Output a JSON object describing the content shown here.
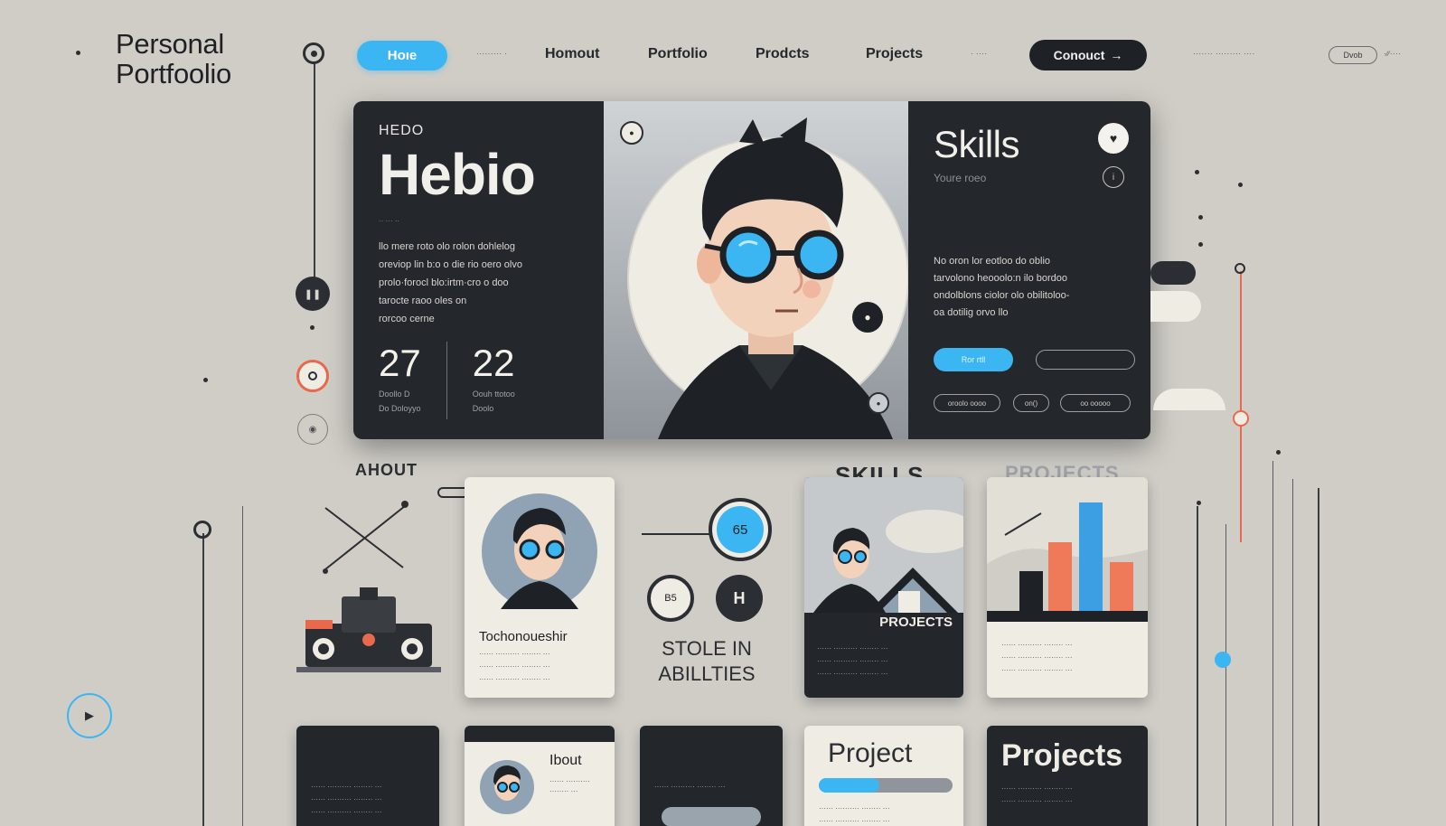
{
  "brand": {
    "line1": "Personal",
    "line2": "Portfoolio"
  },
  "nav": {
    "home": "Hoıe",
    "small1": "·········  ·",
    "about": "Homout",
    "portfolio": "Portfolio",
    "products": "Prodcts",
    "projects": "Projects",
    "small2": "· ····",
    "contact": "Conouct",
    "contact_arrow": "→",
    "right_small": "·······  ········· ····",
    "pill": "Dvob",
    "right_small2": "·∕∕····"
  },
  "hero": {
    "kicker": "HEDO",
    "title": "Hebio",
    "tiny": "·· ··· ··",
    "paragraph": [
      "llo mere roto olo rolon dohlelog",
      "oreviop lin b:o o die rio oero olvo",
      "prolo·forocl blo:irtm·cro o doo",
      "tarocte raoo oles on",
      "rorcoo cerne"
    ],
    "stats": [
      {
        "num": "27",
        "label1": "Doollo D",
        "label2": "Do Doloyyo"
      },
      {
        "num": "22",
        "label1": "Oouh ttotoo",
        "label2": "Doolo"
      }
    ],
    "skills_title": "Skills",
    "skills_sub": "Youre roeo",
    "right_paragraph": [
      "No oron lor eotloo do oblio",
      "tarvolono heooolo:n ilo bordoo",
      "ondolblons ciolor olo obilitoloo-",
      "oa dotilig orvo llo"
    ],
    "btn_blue": "Ror rtll",
    "chips": [
      "oroolo oooo",
      "on()",
      "oo ooooo"
    ]
  },
  "sections": {
    "about": "AHOUT",
    "skills": "SKILLS",
    "projects": "PROJECTS"
  },
  "cards": {
    "profile_name": "Tochonoueshir",
    "skills_caption1": "STOLE IN",
    "skills_caption2": "ABILLTIES",
    "projects_label": "PROJECTS",
    "project_big": "Project",
    "projects_big": "Projects",
    "about_mini": "Ibout",
    "badge_h": "H",
    "badge_65": "65",
    "badge_b5": "B5",
    "text_line": "······ ·········· ········ ···"
  },
  "colors": {
    "accent_blue": "#3cb6f3",
    "accent_red": "#e8694c",
    "dark": "#24272b",
    "bg": "#cfcdc6"
  }
}
